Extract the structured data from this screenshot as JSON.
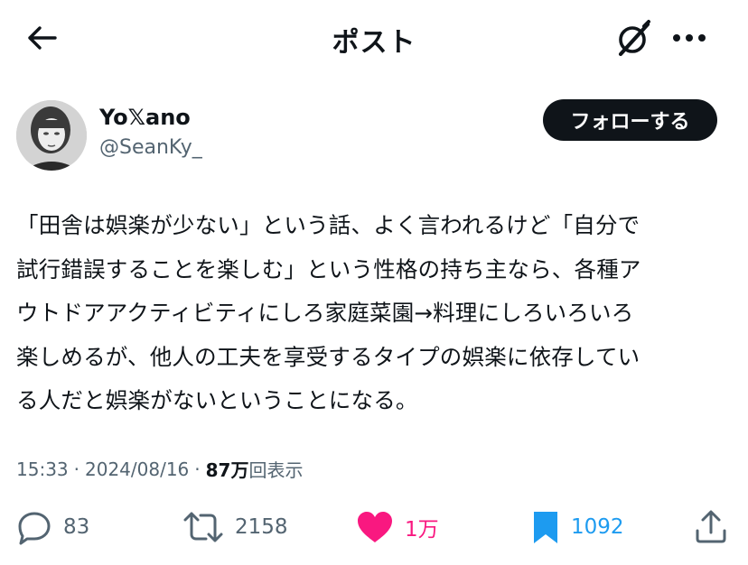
{
  "header": {
    "title": "ポスト"
  },
  "author": {
    "display_name": "Yo𝕏ano",
    "handle": "@SeanKy_",
    "follow_label": "フォローする"
  },
  "post": {
    "text": "「田舎は娯楽が少ない」という話、よく言われるけど「自分で\n試行錯誤することを楽しむ」という性格の持ち主なら、各種ア\nウトドアアクティビティにしろ家庭菜園→料理にしろいろいろ\n楽しめるが、他人の工夫を享受するタイプの娯楽に依存してい\nる人だと娯楽がないということになる。",
    "time": "15:33",
    "separator": "·",
    "date": "2024/08/16",
    "views_count": "87万",
    "views_label": "回表示"
  },
  "actions": {
    "replies": "83",
    "reposts": "2158",
    "likes": "1万",
    "bookmarks": "1092"
  },
  "colors": {
    "like": "#f91880",
    "bookmark": "#1d9bf0",
    "follow_bg": "#0f1419",
    "secondary_text": "#536471"
  },
  "icons": [
    "back-arrow-icon",
    "grok-icon",
    "more-icon",
    "reply-icon",
    "repost-icon",
    "heart-icon",
    "bookmark-icon",
    "share-icon"
  ]
}
